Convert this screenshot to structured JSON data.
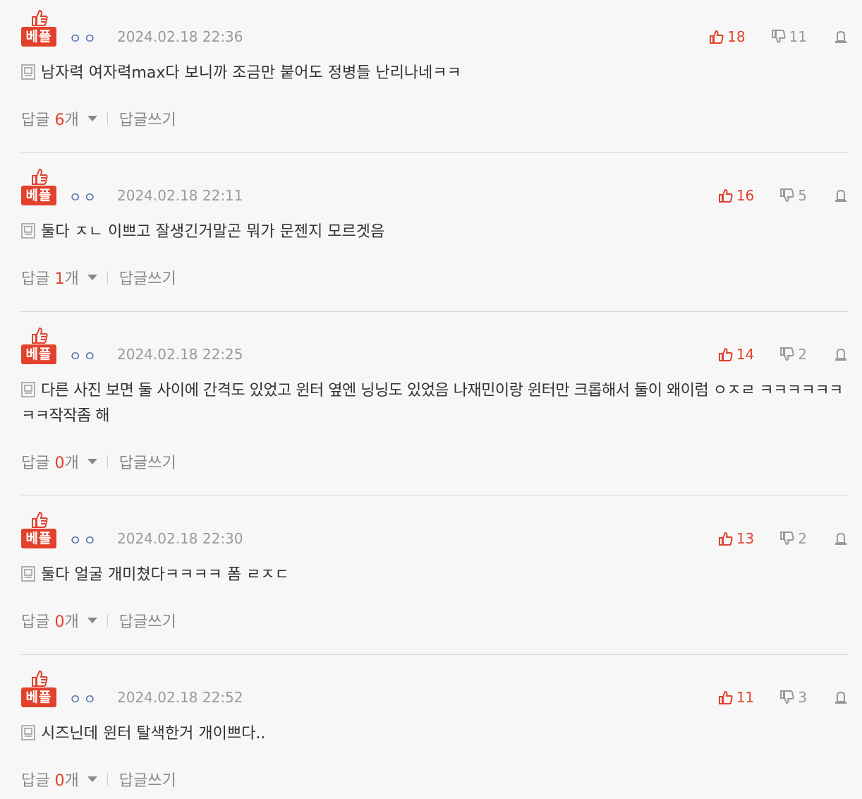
{
  "best_label": "베플",
  "reply_label": "답글",
  "reply_unit": "개",
  "write_reply_label": "답글쓰기",
  "colors": {
    "accent": "#e2412c",
    "nick": "#4a6fb0",
    "muted": "#999999"
  },
  "comments": [
    {
      "nick": "ㅇㅇ",
      "date": "2024.02.18 22:36",
      "up": "18",
      "down": "11",
      "text": "남자력 여자력max다 보니까 조금만 붙어도 정병들 난리나네ㅋㅋ",
      "reply_count": "6"
    },
    {
      "nick": "ㅇㅇ",
      "date": "2024.02.18 22:11",
      "up": "16",
      "down": "5",
      "text": "둘다 ㅈㄴ 이쁘고 잘생긴거말곤 뭐가 문젠지 모르겟음",
      "reply_count": "1"
    },
    {
      "nick": "ㅇㅇ",
      "date": "2024.02.18 22:25",
      "up": "14",
      "down": "2",
      "text": "다른 사진 보면 둘 사이에 간격도 있었고 윈터 옆엔 닝닝도 있었음 나재민이랑 윈터만 크롭해서 둘이 왜이럼 ㅇㅈㄹ ㅋㅋㅋㅋㅋㅋㅋㅋ작작좀 해",
      "reply_count": "0"
    },
    {
      "nick": "ㅇㅇ",
      "date": "2024.02.18 22:30",
      "up": "13",
      "down": "2",
      "text": "둘다 얼굴 개미쳤다ㅋㅋㅋㅋ 폼 ㄹㅈㄷ",
      "reply_count": "0"
    },
    {
      "nick": "ㅇㅇ",
      "date": "2024.02.18 22:52",
      "up": "11",
      "down": "3",
      "text": "시즈닌데 윈터 탈색한거 개이쁘다..",
      "reply_count": "0"
    }
  ]
}
